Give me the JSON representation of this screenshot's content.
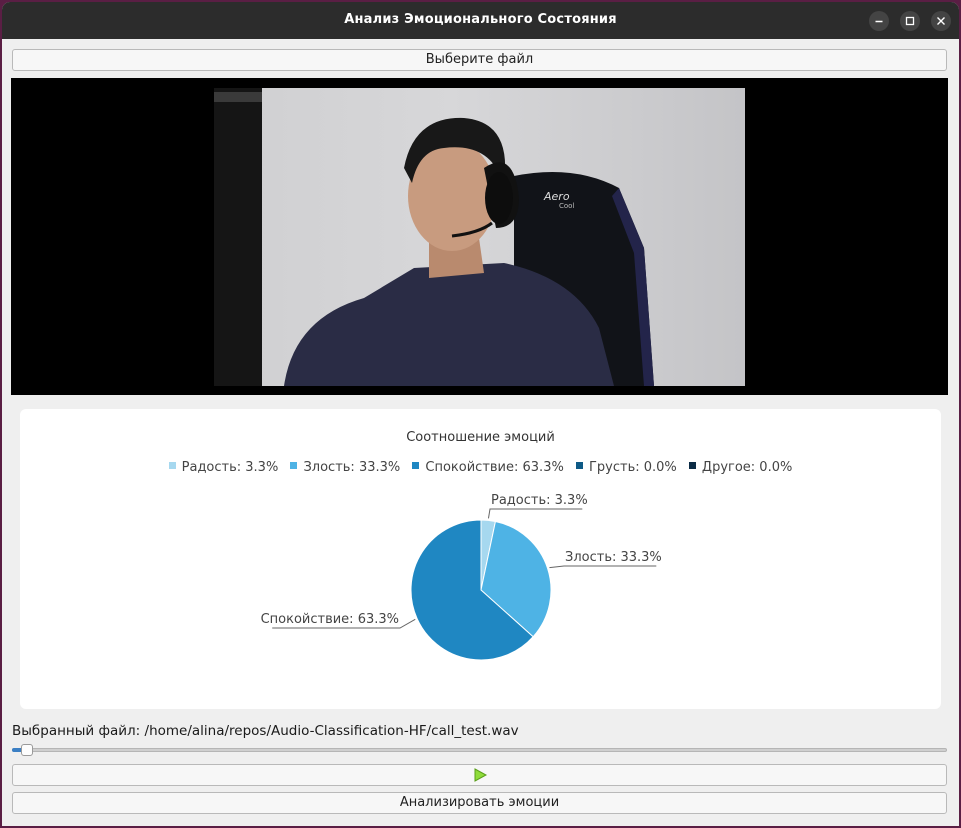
{
  "window": {
    "title": "Анализ Эмоционального Состояния",
    "controls": [
      "minimize-icon",
      "maximize-icon",
      "close-icon"
    ]
  },
  "toolbar": {
    "choose_file_label": "Выберите файл"
  },
  "video": {
    "description_icon": "video-frame"
  },
  "chart_data": {
    "type": "pie",
    "title": "Соотношение эмоций",
    "legend_position": "top",
    "categories": [
      "Радость",
      "Злость",
      "Спокойствие",
      "Грусть",
      "Другое"
    ],
    "values": [
      3.3,
      33.3,
      63.3,
      0.0,
      0.0
    ],
    "colors": [
      "#a6d8ef",
      "#4eb3e5",
      "#1f87c2",
      "#0e5a86",
      "#0b2b45"
    ],
    "legend_labels": [
      "Радость: 3.3%",
      "Злость: 33.3%",
      "Спокойствие: 63.3%",
      "Грусть: 0.0%",
      "Другое: 0.0%"
    ],
    "slice_labels": [
      "Радость: 3.3%",
      "Злость: 33.3%",
      "Спокойствие: 63.3%"
    ]
  },
  "file": {
    "selected_label": "Выбранный файл: /home/alina/repos/Audio-Classification-HF/call_test.wav"
  },
  "player": {
    "position_fraction": 0.01,
    "play_icon": "play-icon"
  },
  "actions": {
    "analyze_label": "Анализировать эмоции"
  },
  "colors": {
    "accent": "#3b7fc4",
    "titlebar": "#2c2c2c",
    "play": "#7ed321"
  }
}
